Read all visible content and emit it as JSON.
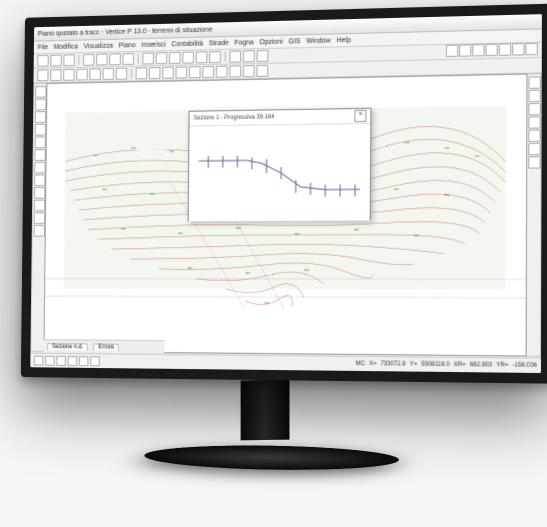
{
  "window": {
    "title": "Piano quotato a tracc - Vertice P 13.0 - terreno di situazione"
  },
  "menu": {
    "items": [
      "File",
      "Modifica",
      "Visualizza",
      "Piano",
      "Inserisci",
      "Contabilità",
      "Strade",
      "Fogna",
      "Opzioni",
      "GIS",
      "Window",
      "Help"
    ]
  },
  "popup": {
    "title": "Sezione 1 - Progressiva   39.184",
    "close_label": "×"
  },
  "tabs": {
    "items": [
      "Sezione n.d.",
      "Errore"
    ]
  },
  "status": {
    "mode": "MC",
    "x_label": "X=",
    "x_val": "733072.9",
    "y_label": "Y=",
    "y_val": "5508118.0",
    "xr_label": "XR=",
    "xr_val": "682.803",
    "yr_label": "YR=",
    "yr_val": "-156.006"
  },
  "colors": {
    "contour": "#c97a6b",
    "section": "#6a5a9a",
    "grid": "#c8a8d0",
    "label": "#2a7a2a"
  }
}
